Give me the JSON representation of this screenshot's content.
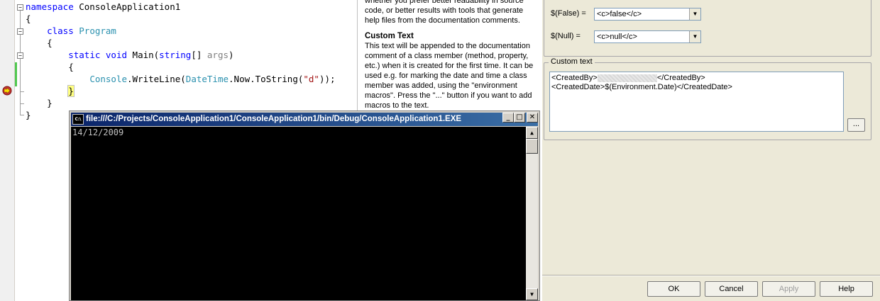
{
  "editor": {
    "lines": [
      {
        "parts": [
          {
            "t": "namespace",
            "c": "kw"
          },
          {
            "t": " ConsoleApplication1",
            "c": ""
          }
        ]
      },
      {
        "parts": [
          {
            "t": "{",
            "c": ""
          }
        ]
      },
      {
        "parts": [
          {
            "t": "    ",
            "c": ""
          },
          {
            "t": "class",
            "c": "kw"
          },
          {
            "t": " ",
            "c": ""
          },
          {
            "t": "Program",
            "c": "ty"
          }
        ]
      },
      {
        "parts": [
          {
            "t": "    {",
            "c": ""
          }
        ]
      },
      {
        "parts": [
          {
            "t": "        ",
            "c": ""
          },
          {
            "t": "static",
            "c": "kw"
          },
          {
            "t": " ",
            "c": ""
          },
          {
            "t": "void",
            "c": "kw"
          },
          {
            "t": " Main(",
            "c": ""
          },
          {
            "t": "string",
            "c": "kw"
          },
          {
            "t": "[] ",
            "c": ""
          },
          {
            "t": "args",
            "c": "gray"
          },
          {
            "t": ")",
            "c": ""
          }
        ]
      },
      {
        "parts": [
          {
            "t": "        {",
            "c": ""
          }
        ]
      },
      {
        "parts": [
          {
            "t": "            ",
            "c": ""
          },
          {
            "t": "Console",
            "c": "ty"
          },
          {
            "t": ".WriteLine(",
            "c": ""
          },
          {
            "t": "DateTime",
            "c": "ty"
          },
          {
            "t": ".Now.ToString(",
            "c": ""
          },
          {
            "t": "\"d\"",
            "c": "str"
          },
          {
            "t": "));",
            "c": ""
          }
        ]
      },
      {
        "parts": [
          {
            "t": "        ",
            "c": ""
          },
          {
            "t": "}",
            "c": "hl"
          }
        ]
      },
      {
        "parts": [
          {
            "t": "    }",
            "c": ""
          }
        ]
      },
      {
        "parts": [
          {
            "t": "}",
            "c": ""
          }
        ]
      }
    ]
  },
  "help": {
    "intro_line1": "whether you prefer better readability in source",
    "intro_line2": "code, or better results with tools that generate",
    "intro_line3": "help files from the documentation comments.",
    "custom_text_heading": "Custom Text",
    "custom_text_body": "This text will be appended to the documentation comment of a class member (method, property, etc.) when it is created for the first time. It can be used e.g. for marking the date and time a class member was added, using the \"environment macros\". Press the \"...\" button if you want to add macros to the text."
  },
  "options": {
    "false_label": "$(False)  =",
    "false_value": "<c>false</c>",
    "null_label": "$(Null)  =",
    "null_value": "<c>null</c>",
    "custom_text_legend": "Custom text",
    "custom_text_line1_start": "<CreatedBy>",
    "custom_text_line1_end": "</CreatedBy>",
    "custom_text_line2": "<CreatedDate>$(Environment.Date)</CreatedDate>",
    "ellipsis_button": "...",
    "ok_button": "OK",
    "cancel_button": "Cancel",
    "apply_button": "Apply",
    "help_button": "Help"
  },
  "console": {
    "icon_text": "C:\\",
    "title": "file:///C:/Projects/ConsoleApplication1/ConsoleApplication1/bin/Debug/ConsoleApplication1.EXE",
    "minimize_glyph": "_",
    "maximize_glyph": "□",
    "close_glyph": "✕",
    "output": "14/12/2009",
    "scroll_up_glyph": "▲",
    "scroll_down_glyph": "▼"
  }
}
